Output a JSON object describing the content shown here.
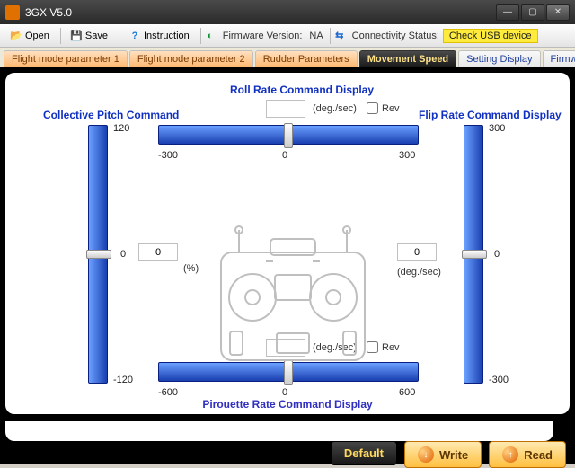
{
  "window": {
    "title": "3GX  V5.0"
  },
  "toolbar": {
    "open": "Open",
    "save": "Save",
    "instruction": "Instruction",
    "fw_label": "Firmware Version:",
    "fw_value": "NA",
    "conn_label": "Connectivity Status:",
    "conn_value": "Check USB device"
  },
  "tabs": {
    "items": [
      "Flight mode parameter 1",
      "Flight mode parameter 2",
      "Rudder Parameters",
      "Movement Speed",
      "Setting Display",
      "Firmware Upgrade"
    ],
    "active_index": 3
  },
  "panel": {
    "roll_title": "Roll Rate Command Display",
    "collective_title": "Collective Pitch Command",
    "flip_title": "Flip Rate Command Display",
    "bottom_title": "Pirouette Rate Command Display",
    "unit_deg": "(deg./sec)",
    "unit_pct": "(%)",
    "rev": "Rev",
    "roll": {
      "value": "",
      "min": "-300",
      "max": "300"
    },
    "bottom": {
      "value": "",
      "min": "-600",
      "max": "600"
    },
    "collective": {
      "value": "0",
      "top": "120",
      "bot": "-120"
    },
    "flip": {
      "value": "0",
      "top": "300",
      "bot": "-300"
    }
  },
  "footer": {
    "default": "Default",
    "write": "Write",
    "read": "Read"
  }
}
